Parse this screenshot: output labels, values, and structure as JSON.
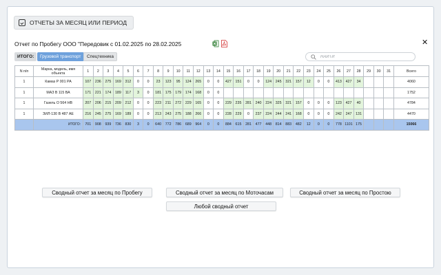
{
  "header": {
    "period_button": "ОТЧЕТЫ ЗА МЕСЯЦ ИЛИ ПЕРИОД",
    "title": "Отчет по Пробегу ООО \"Передовик с 01.02.2025 по 28.02.2025"
  },
  "filters": {
    "total_label": "ИТОГО:",
    "freight": "Грузовой транспорт",
    "special": "Спецтехника"
  },
  "search": {
    "placeholder": "НАЙТИ"
  },
  "table": {
    "col_num": "N п/п",
    "col_model": "Марка, модель, имя объекта",
    "days": [
      "1",
      "2",
      "3",
      "4",
      "5",
      "6",
      "7",
      "8",
      "9",
      "10",
      "11",
      "12",
      "13",
      "14",
      "15",
      "16",
      "17",
      "18",
      "19",
      "20",
      "21",
      "22",
      "23",
      "24",
      "25",
      "26",
      "27",
      "28",
      "29",
      "30",
      "31"
    ],
    "col_total": "Всего",
    "rows": [
      {
        "num": "1",
        "model": "Камаз Р 001 РА",
        "values": [
          "107",
          "236",
          "275",
          "169",
          "312",
          "0",
          "0",
          "23",
          "123",
          "95",
          "124",
          "265",
          "0",
          "0",
          "427",
          "151",
          "0",
          "0",
          "124",
          "245",
          "321",
          "157",
          "12",
          "0",
          "0",
          "413",
          "427",
          "34",
          "",
          "",
          ""
        ],
        "total": "4060"
      },
      {
        "num": "1",
        "model": "МАЗ В 115 ВА",
        "values": [
          "171",
          "221",
          "174",
          "189",
          "117",
          "3",
          "0",
          "181",
          "175",
          "179",
          "174",
          "168",
          "0",
          "0",
          "",
          "",
          "",
          "",
          "",
          "",
          "",
          "",
          "",
          "",
          "",
          "",
          "",
          "",
          "",
          "",
          ""
        ],
        "total": "1752"
      },
      {
        "num": "1",
        "model": "Газель О 564 НВ",
        "values": [
          "207",
          "206",
          "215",
          "209",
          "212",
          "0",
          "0",
          "223",
          "211",
          "272",
          "229",
          "165",
          "0",
          "0",
          "229",
          "235",
          "281",
          "240",
          "224",
          "325",
          "321",
          "157",
          "0",
          "0",
          "0",
          "123",
          "427",
          "40",
          "",
          "",
          ""
        ],
        "total": "4784"
      },
      {
        "num": "1",
        "model": "ЗИЛ-130 В 487 АЕ",
        "values": [
          "216",
          "245",
          "275",
          "169",
          "189",
          "0",
          "0",
          "213",
          "243",
          "275",
          "188",
          "266",
          "0",
          "0",
          "228",
          "229",
          "0",
          "237",
          "224",
          "244",
          "241",
          "168",
          "0",
          "0",
          "0",
          "242",
          "247",
          "131",
          "",
          "",
          ""
        ],
        "total": "4470"
      }
    ],
    "total_row": {
      "label": "ИТОГО:",
      "values": [
        "701",
        "908",
        "939",
        "736",
        "830",
        "3",
        "0",
        "640",
        "772",
        "786",
        "689",
        "964",
        "0",
        "0",
        "884",
        "615",
        "281",
        "477",
        "448",
        "814",
        "883",
        "482",
        "12",
        "0",
        "0",
        "778",
        "1101",
        "175",
        "",
        "",
        ""
      ],
      "total": "15066"
    }
  },
  "reports": {
    "mileage": "Сводный отчет за месяц по Пробегу",
    "engine_hours": "Сводный отчет за месяц по Моточасам",
    "idle": "Сводный отчет за месяц по Простою",
    "any": "Любой сводный отчет"
  },
  "colors": {
    "accent": "#6ea1dc",
    "cell_green": "#e3f5dc",
    "total_row": "#a9c6ee"
  }
}
